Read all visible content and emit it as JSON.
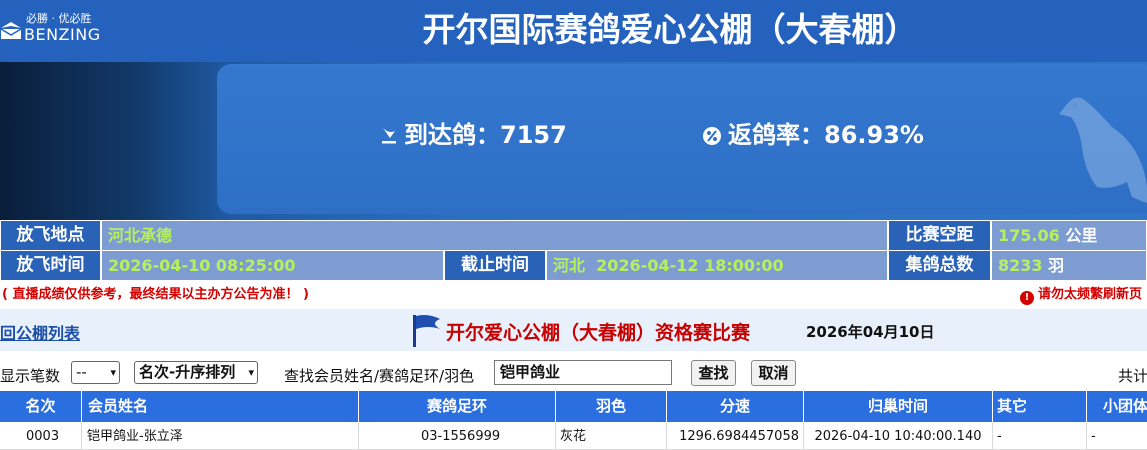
{
  "header": {
    "logo_slogan": "必勝 · 优必胜",
    "logo_name": "BENZING",
    "title": "开尔国际赛鸽爱心公棚（大春棚）"
  },
  "banner": {
    "arrived_label": "到达鸽：",
    "arrived_value": "7157",
    "rate_label": "返鸽率：",
    "rate_value": "86.93%"
  },
  "info": {
    "release_place_label": "放飞地点",
    "release_place_value": "河北承德",
    "distance_label": "比赛空距",
    "distance_value": "175.06",
    "distance_unit": "公里（KM）",
    "release_time_label": "放飞时间",
    "release_time_value": "2026-04-10 08:25:00",
    "deadline_label": "截止时间",
    "deadline_region": "河北",
    "deadline_value": "2026-04-12 18:00:00",
    "total_label": "集鸽总数",
    "total_value": "8233",
    "total_unit": "羽"
  },
  "notice": {
    "left": "( 直播成绩仅供参考，最终结果以主办方公告为准！ )",
    "right": "请勿太频繁刷新页"
  },
  "subhead": {
    "back_link": "回公棚列表",
    "title": "开尔爱心公棚（大春棚）资格赛比赛",
    "date": "2026年04月10日"
  },
  "toolbar": {
    "show_count_label": "显示笔数",
    "show_count_value": "--",
    "sort_value": "名次-升序排列",
    "search_label": "查找会员姓名/赛鸽足环/羽色",
    "search_value": "铠甲鸽业",
    "search_button": "查找",
    "cancel_button": "取消",
    "total_prefix": "共计"
  },
  "table": {
    "headers": [
      "名次",
      "会员姓名",
      "赛鸽足环",
      "羽色",
      "分速",
      "归巢时间",
      "其它",
      "小团体"
    ],
    "rows": [
      [
        "0003",
        "铠甲鸽业-张立泽",
        "03-1556999",
        "灰花",
        "1296.6984457058",
        "2026-04-10 10:40:00.140",
        "-",
        "-"
      ]
    ]
  },
  "colors": {
    "header_blue": "#2462bd",
    "label_blue": "#2a62b8",
    "value_bg": "#7c9cd2",
    "value_green": "#b8f05c",
    "table_header": "#2a6ee0",
    "notice_red": "#d40000",
    "title_red": "#c80000"
  },
  "icons": {
    "logo": "benzing-logo-icon",
    "arrived": "pigeon-landing-icon",
    "rate": "percent-icon",
    "banner_art": "pigeon-silhouette-icon",
    "notice": "warning-icon",
    "subhead": "flag-icon"
  }
}
